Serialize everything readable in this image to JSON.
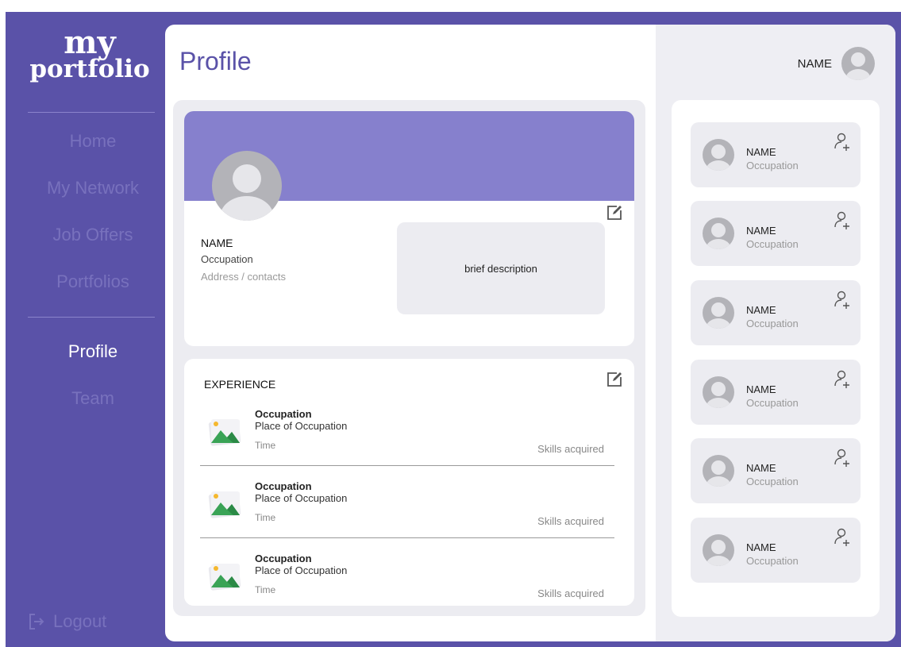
{
  "app": {
    "logo_line1": "my",
    "logo_line2": "portfolio"
  },
  "sidebar": {
    "items": [
      {
        "label": "Home",
        "active": false
      },
      {
        "label": "My Network",
        "active": false
      },
      {
        "label": "Job Offers",
        "active": false
      },
      {
        "label": "Portfolios",
        "active": false
      },
      {
        "label": "Profile",
        "active": true
      },
      {
        "label": "Team",
        "active": false
      }
    ],
    "logout_label": "Logout"
  },
  "header": {
    "title": "Profile",
    "user_name": "NAME"
  },
  "profile": {
    "name": "NAME",
    "occupation": "Occupation",
    "address": "Address / contacts",
    "description": "brief description"
  },
  "experience": {
    "title": "EXPERIENCE",
    "items": [
      {
        "occupation": "Occupation",
        "place": "Place of Occupation",
        "time": "Time",
        "skills": "Skills acquired"
      },
      {
        "occupation": "Occupation",
        "place": "Place of Occupation",
        "time": "Time",
        "skills": "Skills acquired"
      },
      {
        "occupation": "Occupation",
        "place": "Place of Occupation",
        "time": "Time",
        "skills": "Skills acquired"
      }
    ]
  },
  "people": [
    {
      "name": "NAME",
      "occupation": "Occupation"
    },
    {
      "name": "NAME",
      "occupation": "Occupation"
    },
    {
      "name": "NAME",
      "occupation": "Occupation"
    },
    {
      "name": "NAME",
      "occupation": "Occupation"
    },
    {
      "name": "NAME",
      "occupation": "Occupation"
    },
    {
      "name": "NAME",
      "occupation": "Occupation"
    }
  ],
  "colors": {
    "brand": "#5a52a8",
    "banner": "#8680cd",
    "nav_inactive": "#7871bd",
    "card_bg": "#ececf1"
  },
  "icons": {
    "edit": "edit-icon",
    "add_user": "add-user-icon",
    "logout": "logout-icon",
    "image": "image-icon",
    "avatar": "avatar-icon"
  }
}
